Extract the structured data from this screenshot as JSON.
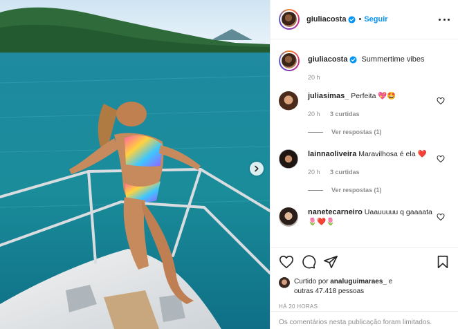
{
  "post": {
    "author": "giuliacosta",
    "follow_label": "Seguir",
    "dot": "•",
    "caption": "Summertime vibes",
    "caption_time": "20 h"
  },
  "comments": [
    {
      "user": "juliasimas_",
      "text": "Perfeita 💖🤩",
      "time": "20 h",
      "likes": "3 curtidas",
      "replies": "Ver respostas (1)"
    },
    {
      "user": "lainnaoliveira",
      "text": "Maravilhosa é ela ❤️",
      "time": "20 h",
      "likes": "3 curtidas",
      "replies": "Ver respostas (1)"
    },
    {
      "user": "nanetecarneiro",
      "text": "Uaauuuuu q gaaaata 🌷❤️🌷"
    }
  ],
  "likes": {
    "prefix": "Curtido por",
    "user": "analuguimaraes_",
    "conj": "e",
    "others": "outras 47.418 pessoas"
  },
  "timestamp": "HÁ 20 HORAS",
  "comments_limited": "Os comentários nesta publicação foram limitados.",
  "icons": {
    "more": "more-options-icon",
    "verified": "verified-badge-icon",
    "like": "heart-icon",
    "comment": "comment-bubble-icon",
    "share": "paper-plane-icon",
    "save": "bookmark-icon",
    "next": "chevron-right-icon"
  },
  "colors": {
    "accent": "#0095f6",
    "text": "#262626",
    "muted": "#8e8e8e",
    "border": "#efefef"
  }
}
